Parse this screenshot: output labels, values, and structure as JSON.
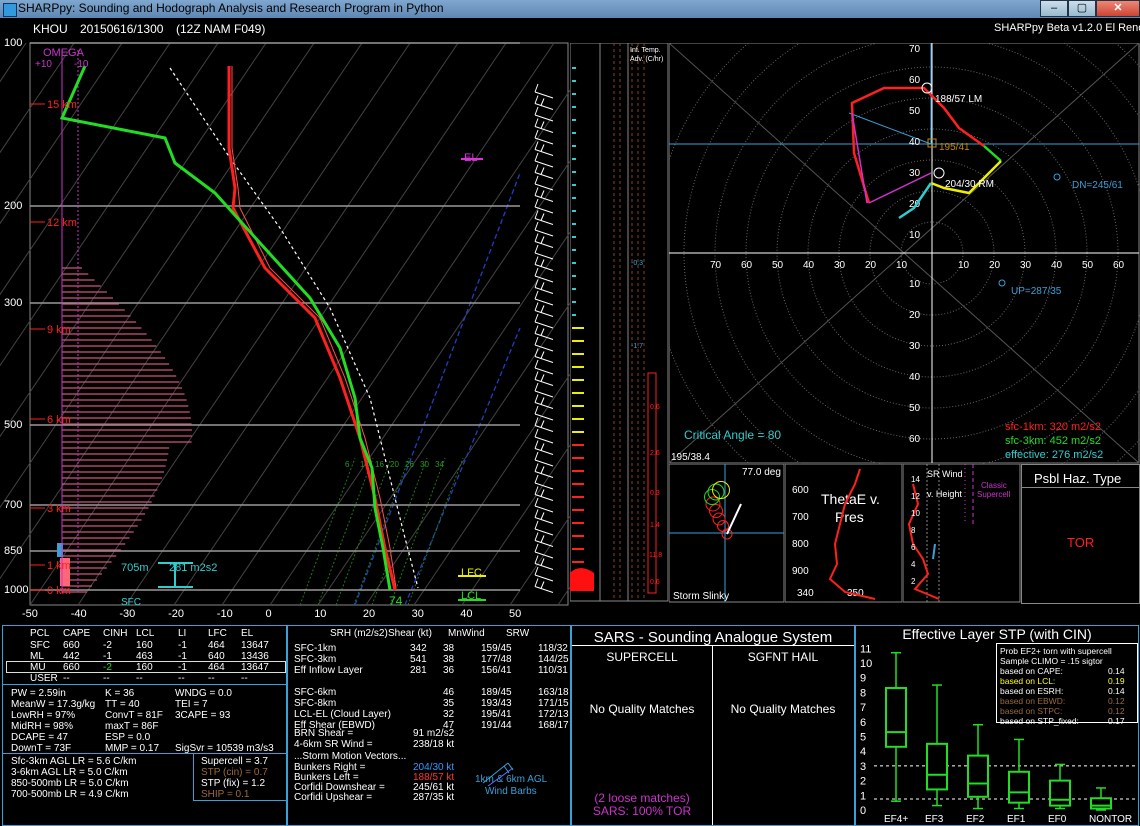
{
  "window": {
    "title": "SHARPpy: Sounding and Hodograph Analysis and Research Program in Python",
    "btn_min": "–",
    "btn_max": "▢",
    "btn_close": "✕"
  },
  "header": {
    "station": "KHOU",
    "datetime": "20150616/1300",
    "model": "(12Z  NAM  F049)",
    "version": "SHARPpy Beta v1.2.0 El Reno"
  },
  "skewt": {
    "pressure_labels": [
      "100",
      "200",
      "300",
      "500",
      "700",
      "850",
      "1000"
    ],
    "temp_labels": [
      "-50",
      "-40",
      "-30",
      "-20",
      "-10",
      "0",
      "10",
      "20",
      "30",
      "40",
      "50"
    ],
    "height_labels": [
      "15 km",
      "12 km",
      "9 km",
      "6 km",
      "3 km",
      "1 km",
      "0 km"
    ],
    "omega_title": "OMEGA",
    "omega_left": "+10",
    "omega_right": "-10",
    "el_label": "EL",
    "lfc_label": "LFC",
    "lcl_label": "LCL",
    "sfc_label": "SFC",
    "sfc_temp": "74",
    "eff_inflow_depth": "705m",
    "eff_inflow_srh": "281 m2s2",
    "mixing_ratios": [
      "6",
      "14",
      "16",
      "20",
      "26",
      "30",
      "34"
    ],
    "colors": {
      "temp": "#ff2020",
      "dewp": "#22dd22",
      "virtual": "#ff4040",
      "parcel": "#ffffff"
    }
  },
  "inferred_adv": {
    "title_line1": "Inf. Temp.",
    "title_line2": "Adv. (C/hr)",
    "values": [
      "-0.3",
      "-1.7",
      "0.6",
      "2.6",
      "0.3",
      "1.4",
      "11.8",
      "0.6"
    ]
  },
  "hodograph": {
    "speed_labels": [
      "70",
      "60",
      "50",
      "40",
      "30",
      "20",
      "10",
      "10",
      "20",
      "30",
      "40",
      "50",
      "60",
      "70"
    ],
    "y_labels_up": [
      "70",
      "60",
      "50",
      "40",
      "30",
      "20",
      "10"
    ],
    "y_labels_down": [
      "10",
      "20",
      "30",
      "40",
      "50",
      "60",
      "70"
    ],
    "lm_label": "188/57 LM",
    "rm_label": "204/30 RM",
    "mean_label": "195/41",
    "dn_label": "DN=245/61",
    "up_label": "UP=287/35",
    "critical_angle": "Critical Angle = 80",
    "mean_vec": "195/38.4",
    "srh1": "sfc-1km: 320 m2/s2",
    "srh3": "sfc-3km: 452 m2/s2",
    "srh_eff": "effective: 276 m2/s2"
  },
  "slinky": {
    "angle": "77.0 deg",
    "title": "Storm Slinky"
  },
  "thetae": {
    "title_line1": "ThetaE v.",
    "title_line2": "Pres",
    "pressures": [
      "600",
      "700",
      "800",
      "900"
    ],
    "x_labels": [
      "340",
      "350"
    ]
  },
  "srwind": {
    "title_line1": "SR Wind",
    "title_line2": "v. Height",
    "classic_line1": "Classic",
    "classic_line2": "Supercell",
    "heights": [
      "14",
      "12",
      "10",
      "8",
      "6",
      "4",
      "2"
    ]
  },
  "hazard": {
    "title": "Psbl Haz. Type",
    "value": "TOR"
  },
  "thermo": {
    "headers": [
      "PCL",
      "CAPE",
      "CINH",
      "LCL",
      "LI",
      "LFC",
      "EL"
    ],
    "rows": [
      [
        "SFC",
        "660",
        "-2",
        "160",
        "-1",
        "464",
        "13647"
      ],
      [
        "ML",
        "442",
        "-1",
        "463",
        "-1",
        "640",
        "13436"
      ],
      [
        "MU",
        "660",
        "-2",
        "160",
        "-1",
        "464",
        "13647"
      ],
      [
        "USER",
        "--",
        "--",
        "--",
        "--",
        "--",
        "--"
      ]
    ],
    "indices": [
      [
        "PW = 2.59in",
        "K = 36",
        "WNDG = 0.0"
      ],
      [
        "MeanW = 17.3g/kg",
        "TT = 40",
        "TEI = 7"
      ],
      [
        "LowRH = 97%",
        "ConvT = 81F",
        "3CAPE = 93"
      ],
      [
        "MidRH = 98%",
        "maxT = 86F",
        ""
      ],
      [
        "DCAPE = 47",
        "ESP = 0.0",
        ""
      ],
      [
        "DownT = 73F",
        "MMP = 0.17",
        "SigSvr = 10539 m3/s3"
      ]
    ],
    "lapse": [
      "Sfc-3km AGL LR = 5.6 C/km",
      "3-6km AGL LR = 5.0 C/km",
      "850-500mb LR = 5.0 C/km",
      "700-500mb LR = 4.9 C/km"
    ],
    "composite": [
      {
        "label": "Supercell = 3.7",
        "color": "#ffffff"
      },
      {
        "label": "STP (cin) = 0.7",
        "color": "#9a6a3a"
      },
      {
        "label": "STP (fix) = 1.2",
        "color": "#ffffff"
      },
      {
        "label": "SHIP = 0.1",
        "color": "#9a6a3a"
      }
    ]
  },
  "kinematics": {
    "headers": [
      "SRH (m2/s2)",
      "Shear (kt)",
      "MnWind",
      "SRW"
    ],
    "rows": [
      [
        "SFC-1km",
        "342",
        "38",
        "159/45",
        "118/32"
      ],
      [
        "SFC-3km",
        "541",
        "38",
        "177/48",
        "144/25"
      ],
      [
        "Eff Inflow Layer",
        "281",
        "36",
        "156/41",
        "110/31"
      ],
      [
        "",
        "",
        "",
        "",
        ""
      ],
      [
        "SFC-6km",
        "",
        "46",
        "189/45",
        "163/18"
      ],
      [
        "SFC-8km",
        "",
        "35",
        "193/43",
        "171/15"
      ],
      [
        "LCL-EL (Cloud Layer)",
        "",
        "32",
        "195/41",
        "172/13"
      ],
      [
        "Eff Shear (EBWD)",
        "",
        "47",
        "191/44",
        "168/17"
      ]
    ],
    "brn_label": "BRN Shear =",
    "brn_value": "91 m2/s2",
    "sr46_label": "4-6km SR Wind =",
    "sr46_value": "238/18 kt",
    "storm_motion": "...Storm Motion Vectors...",
    "vectors": [
      {
        "label": "Bunkers Right =",
        "value": "204/30 kt",
        "color": "#3399ff"
      },
      {
        "label": "Bunkers Left =",
        "value": "188/57 kt",
        "color": "#ff3333"
      },
      {
        "label": "Corfidi Downshear =",
        "value": "245/61 kt",
        "color": "#ffffff"
      },
      {
        "label": "Corfidi Upshear =",
        "value": "287/35 kt",
        "color": "#ffffff"
      }
    ],
    "barb_legend_line1": "1km & 6km AGL",
    "barb_legend_line2": "Wind Barbs"
  },
  "sars": {
    "title": "SARS - Sounding Analogue System",
    "supercell": "SUPERCELL",
    "hail": "SGFNT HAIL",
    "supercell_match": "No Quality Matches",
    "hail_match": "No Quality Matches",
    "loose": "(2 loose matches)",
    "tor": "SARS: 100% TOR"
  },
  "stp": {
    "title": "Effective Layer STP (with CIN)",
    "y_labels": [
      "11",
      "10",
      "9",
      "8",
      "7",
      "6",
      "5",
      "4",
      "3",
      "2",
      "1",
      "0"
    ],
    "categories": [
      "EF4+",
      "EF3",
      "EF2",
      "EF1",
      "EF0",
      "NONTOR"
    ],
    "box_title": "Prob EF2+ torn with supercell",
    "box_sub": "Sample CLIMO = .15 sigtor",
    "box_rows": [
      {
        "label": "based on CAPE:",
        "value": "0.14",
        "color": "#ffffff"
      },
      {
        "label": "based on LCL:",
        "value": "0.19",
        "color": "#ffff00"
      },
      {
        "label": "based on ESRH:",
        "value": "0.14",
        "color": "#ffffff"
      },
      {
        "label": "based on EBWD:",
        "value": "0.12",
        "color": "#9a6a3a"
      },
      {
        "label": "based on STPC:",
        "value": "0.12",
        "color": "#9a6a3a"
      },
      {
        "label": "based on STP_fixed:",
        "value": "0.17",
        "color": "#ffffff"
      }
    ]
  }
}
